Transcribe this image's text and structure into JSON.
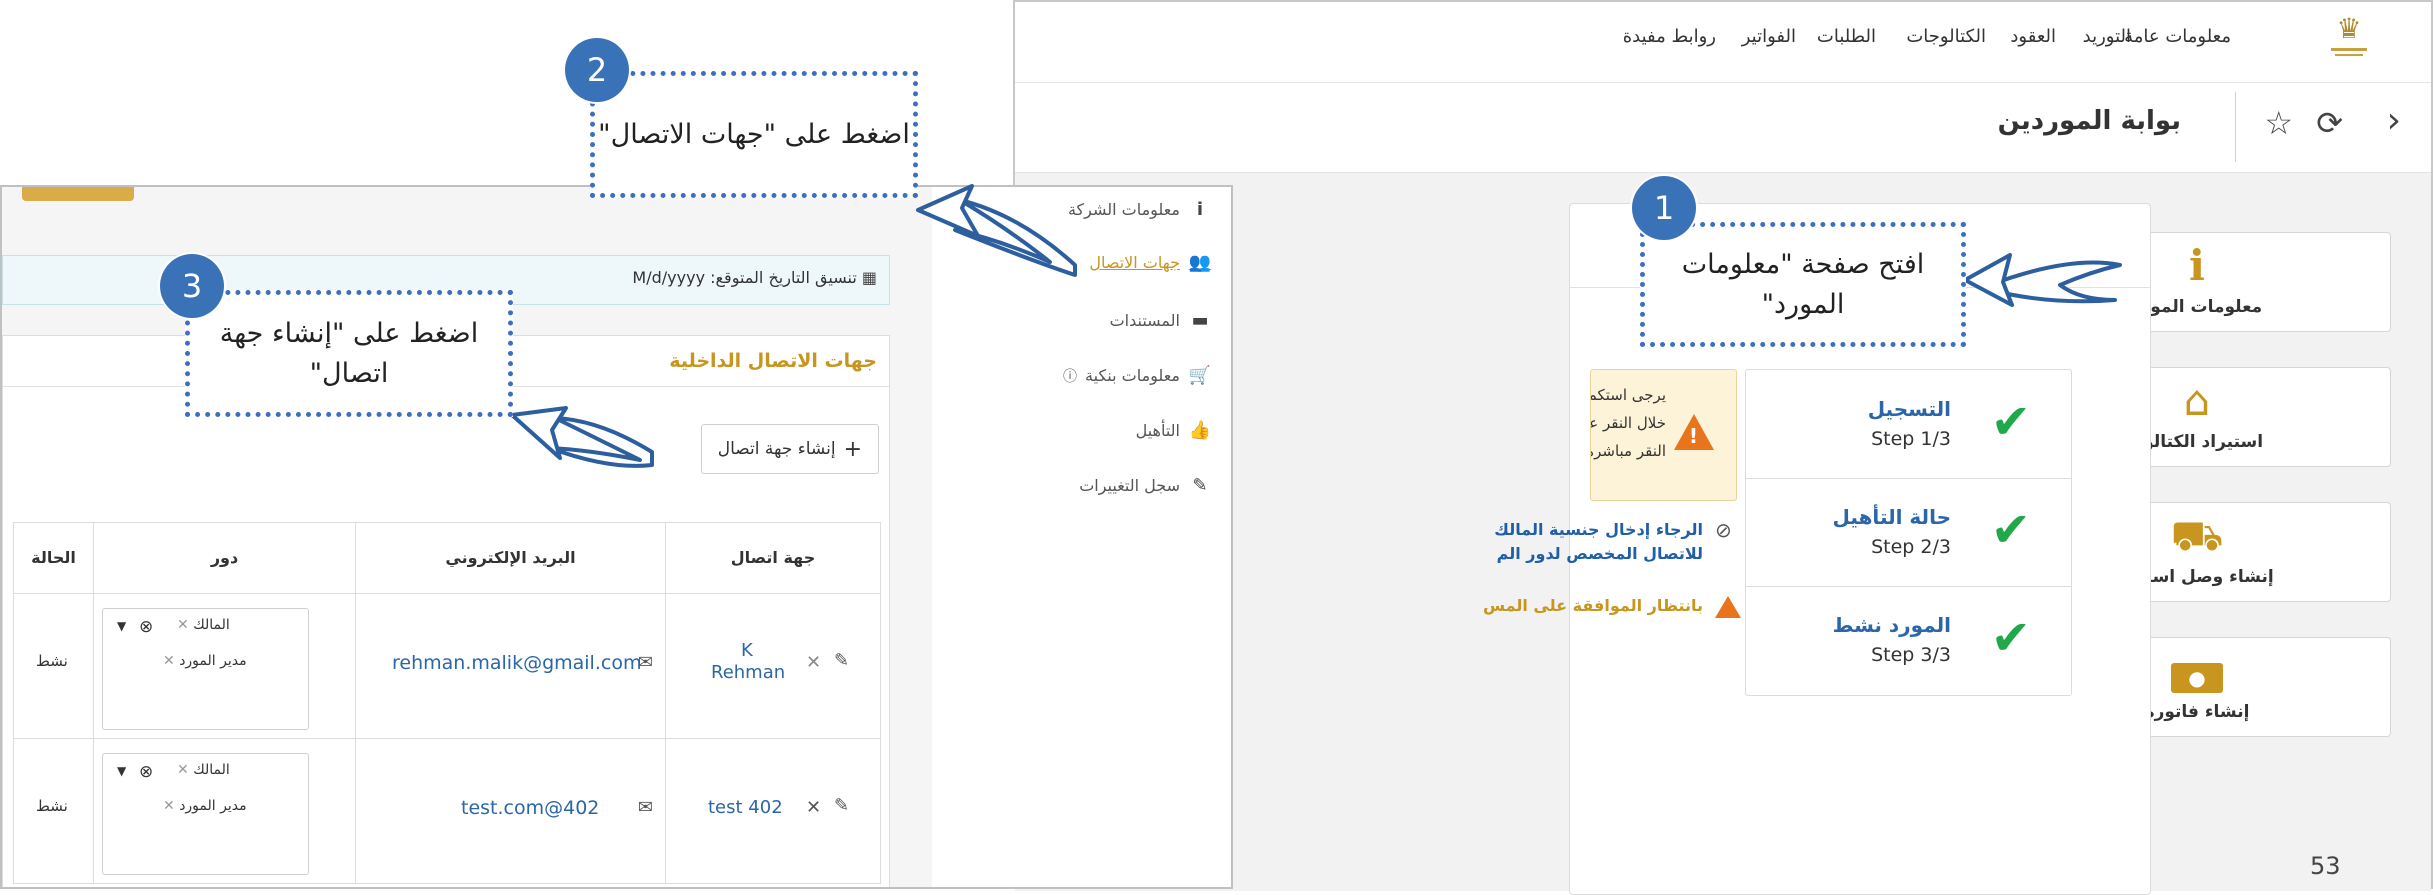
{
  "portal": {
    "nav": [
      "معلومات عامة",
      "التوريد",
      "العقود",
      "الكتالوجات",
      "الطلبات",
      "الفواتير",
      "روابط مفيدة"
    ],
    "title": "بوابة الموردين",
    "tiles": [
      {
        "label": "معلومات المورد",
        "icon": "info-icon"
      },
      {
        "label": "استيراد الكتالوج",
        "icon": "basket-icon"
      },
      {
        "label": "إنشاء وصل استلام",
        "icon": "truck-icon"
      },
      {
        "label": "إنشاء فاتورة",
        "icon": "cash-icon"
      }
    ],
    "steps": [
      {
        "title": "التسجيل",
        "sub": "Step 1/3"
      },
      {
        "title": "حالة التأهيل",
        "sub": "Step 2/3"
      },
      {
        "title": "المورد نشط",
        "sub": "Step 3/3"
      }
    ],
    "warning_lines": [
      "يرجى استكمال التفاصيل",
      "خلال النقر على \"معلومات",
      "النقر مباشرة على الصناد"
    ],
    "note1_lines": [
      "الرجاء إدخال جنسية المالك",
      "للاتصال المخصص لدور الم"
    ],
    "note2": "بانتظار الموافقة على المس",
    "page_number": "53"
  },
  "contacts": {
    "menu": [
      {
        "label": "معلومات الشركة",
        "icon": "info-icon"
      },
      {
        "label": "جهات الاتصال",
        "icon": "users-icon",
        "active": true
      },
      {
        "label": "المستندات",
        "icon": "document-icon"
      },
      {
        "label": "معلومات بنكية",
        "icon": "cart-icon"
      },
      {
        "label": "التأهيل",
        "icon": "thumbs-up-icon"
      },
      {
        "label": "سجل التغييرات",
        "icon": "edit-icon"
      }
    ],
    "date_format": "تنسيق التاريخ المتوقع: M/d/yyyy",
    "panel_title": "جهات الاتصال الداخلية",
    "create_button": "إنشاء جهة اتصال",
    "headers": {
      "contact": "جهة اتصال",
      "email": "البريد الإلكتروني",
      "role": "دور",
      "status": "الحالة"
    },
    "rows": [
      {
        "contact_line1": "K",
        "contact_line2": "Rehman",
        "email": "rehman.malik@gmail.com",
        "roles": [
          "المالك",
          "مدير المورد"
        ],
        "status": "نشط"
      },
      {
        "contact_line1": "test 402",
        "contact_line2": "",
        "email": "test.com@402",
        "roles": [
          "المالك",
          "مدير المورد"
        ],
        "status": "نشط"
      }
    ]
  },
  "annotations": [
    {
      "number": "1",
      "text": "افتح صفحة \"معلومات المورد\""
    },
    {
      "number": "2",
      "text": "اضغط على \"جهات الاتصال\""
    },
    {
      "number": "3",
      "text": "اضغط على \"إنشاء جهة اتصال\""
    }
  ],
  "colors": {
    "accent_gold": "#c8951e",
    "link_blue": "#2b66a8",
    "check_green": "#21a84a",
    "callout_blue": "#3c6fbf"
  }
}
